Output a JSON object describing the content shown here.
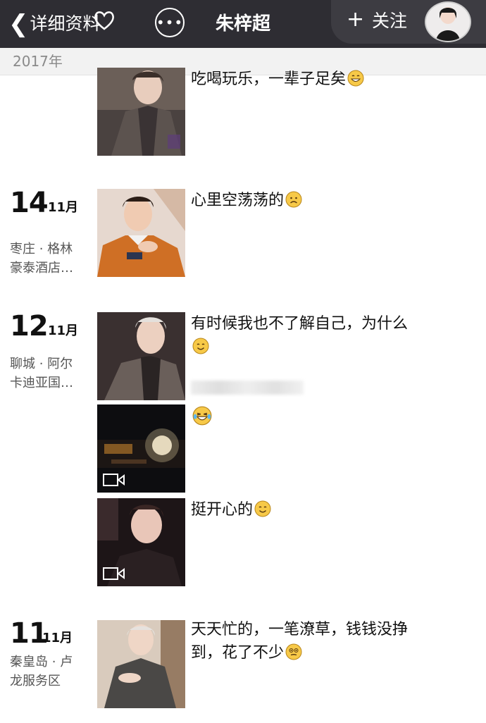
{
  "header": {
    "back_label": "详细资料",
    "title": "朱梓超",
    "follow_label": "关注",
    "plus": "+"
  },
  "year": "2017年",
  "posts": [
    {
      "text": "吃喝玩乐，一辈子足矣",
      "emoji": "grin-emoji"
    },
    {
      "day": "14",
      "month": "11月",
      "location": [
        "枣庄 · 格林",
        "豪泰酒店…"
      ],
      "text": "心里空荡荡的",
      "emoji": "sad-emoji"
    },
    {
      "day": "12",
      "month": "11月",
      "location": [
        "聊城 · 阿尔",
        "卡迪亚国…"
      ],
      "text_lines": [
        "有时候我也不了解自己，为什么"
      ],
      "emoji": "smile-emoji"
    },
    {
      "emoji": "laugh-cry-emoji",
      "type": "video"
    },
    {
      "text": "挺开心的",
      "emoji": "smile-emoji",
      "type": "video"
    },
    {
      "day": "11",
      "month": "11月",
      "location": [
        "秦皇岛 · 卢",
        "龙服务区"
      ],
      "text_lines": [
        "天天忙的，一笔潦草，钱钱没挣",
        "到，花了不少"
      ],
      "emoji": "dizzy-emoji"
    }
  ]
}
